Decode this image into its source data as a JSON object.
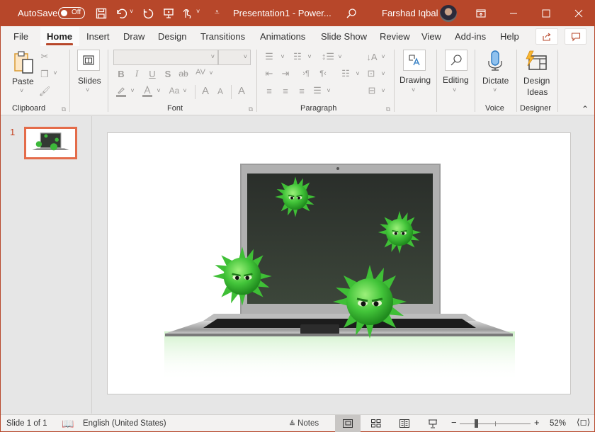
{
  "titlebar": {
    "autosave_label": "AutoSave",
    "autosave_state": "Off",
    "document_title": "Presentation1  -  Power...",
    "user_name": "Farshad Iqbal",
    "icons": [
      "save-icon",
      "undo-icon",
      "redo-icon",
      "present-from-start-icon",
      "touch-mode-icon",
      "customize-qat-icon",
      "search-icon",
      "ribbon-display-options-icon",
      "minimize-icon",
      "maximize-icon",
      "close-icon"
    ]
  },
  "tabs": [
    {
      "label": "File"
    },
    {
      "label": "Home",
      "active": true
    },
    {
      "label": "Insert"
    },
    {
      "label": "Draw"
    },
    {
      "label": "Design"
    },
    {
      "label": "Transitions"
    },
    {
      "label": "Animations"
    },
    {
      "label": "Slide Show"
    },
    {
      "label": "Review"
    },
    {
      "label": "View"
    },
    {
      "label": "Add-ins"
    },
    {
      "label": "Help"
    }
  ],
  "tab_buttons": {
    "share": "share-icon",
    "comments": "comments-icon"
  },
  "ribbon": {
    "clipboard": {
      "label": "Clipboard",
      "paste": "Paste"
    },
    "slides": {
      "label": "Slides"
    },
    "font": {
      "label": "Font",
      "font_name": "",
      "font_size": "",
      "bold": "B",
      "italic": "I",
      "underline": "U",
      "shadow": "S",
      "strike": "ab",
      "spacing": "AV",
      "case": "Aa",
      "grow": "A",
      "shrink": "A",
      "clear": "A"
    },
    "paragraph": {
      "label": "Paragraph"
    },
    "drawing": {
      "label": "Drawing"
    },
    "editing": {
      "label": "Editing"
    },
    "voice": {
      "label": "Voice",
      "dictate": "Dictate"
    },
    "designer": {
      "label": "Designer",
      "design_ideas_1": "Design",
      "design_ideas_2": "Ideas"
    }
  },
  "thumbnails": [
    {
      "number": "1",
      "selected": true
    }
  ],
  "slide": {
    "image_description": "Laptop with green spiky virus characters"
  },
  "status": {
    "slide_info": "Slide 1 of 1",
    "language": "English (United States)",
    "notes": "Notes",
    "zoom": "52%",
    "zoom_fraction": 0.52
  },
  "colors": {
    "accent": "#b7472a",
    "selection": "#e46c4a",
    "virus": "#4cc53a"
  }
}
